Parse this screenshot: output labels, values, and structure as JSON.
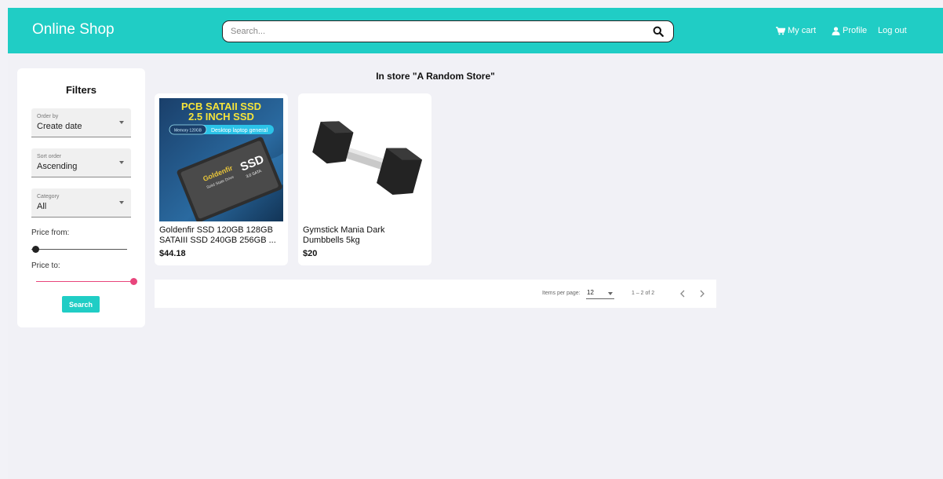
{
  "header": {
    "brand": "Online Shop",
    "search_placeholder": "Search...",
    "nav": {
      "cart": "My cart",
      "profile": "Profile",
      "logout": "Log out"
    }
  },
  "filters": {
    "title": "Filters",
    "order_by": {
      "label": "Order by",
      "value": "Create date"
    },
    "sort_order": {
      "label": "Sort order",
      "value": "Ascending"
    },
    "category": {
      "label": "Category",
      "value": "All"
    },
    "price_from": {
      "label": "Price from:",
      "value_fraction": 0.0
    },
    "price_to": {
      "label": "Price to:",
      "value_fraction": 1.0
    },
    "search_button": "Search"
  },
  "store_title": "In store \"A Random Store\"",
  "products": [
    {
      "name": "Goldenfir SSD 120GB 128GB SATAIII SSD 240GB 256GB ...",
      "price": "$44.18",
      "image_text": {
        "headline1": "PCB SATAII SSD",
        "headline2": "2.5 INCH SSD",
        "badge": "Memory 120GB",
        "tag": "Desktop laptop general",
        "brand": "Goldenfir",
        "sub": "Solid State Drive",
        "ssd": "SSD",
        "sata": "3.0 SATA"
      }
    },
    {
      "name": "Gymstick Mania Dark Dumbbells 5kg",
      "price": "$20"
    }
  ],
  "pagination": {
    "items_per_page_label": "Items per page:",
    "items_per_page": "12",
    "range": "1 – 2 of 2"
  },
  "colors": {
    "accent": "#20cdc5",
    "slider_pink": "#e8457c"
  }
}
